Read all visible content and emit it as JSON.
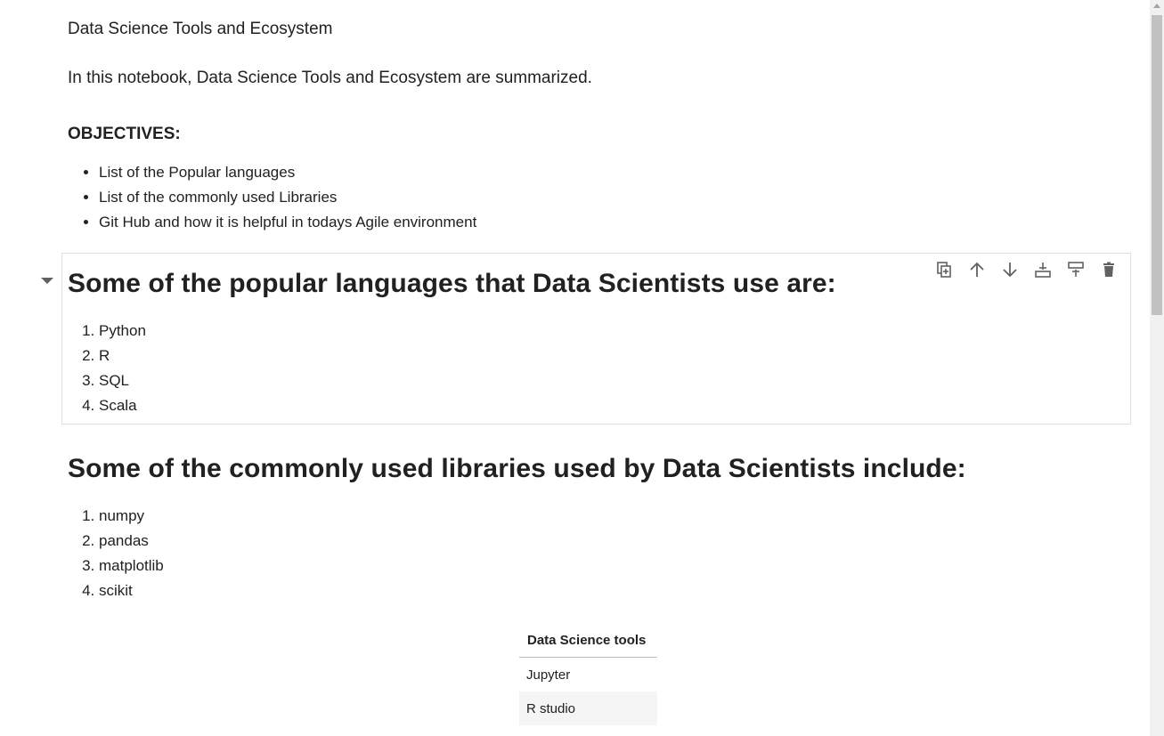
{
  "notebook": {
    "title": "Data Science Tools and Ecosystem",
    "intro": "In this notebook, Data Science Tools and Ecosystem are summarized.",
    "objectives_heading": "OBJECTIVES:",
    "objectives": [
      "List of the Popular languages",
      "List of the commonly used Libraries",
      "Git Hub and how it is helpful in todays Agile environment"
    ],
    "languages_heading": "Some of the popular languages that Data Scientists use are:",
    "languages": [
      "Python",
      "R",
      "SQL",
      "Scala"
    ],
    "libraries_heading": "Some of the commonly used libraries used by Data Scientists include:",
    "libraries": [
      "numpy",
      "pandas",
      "matplotlib",
      "scikit"
    ],
    "tools_table": {
      "header": "Data Science tools",
      "rows": [
        "Jupyter",
        "R studio"
      ]
    }
  },
  "cell_toolbar": {
    "icons": [
      "duplicate-icon",
      "move-up-icon",
      "move-down-icon",
      "insert-above-icon",
      "insert-below-icon",
      "delete-icon"
    ]
  },
  "colors": {
    "text": "#212121",
    "icon": "#616161",
    "cell_border": "#e0e0e0",
    "table_alt_row": "#f5f5f5"
  }
}
